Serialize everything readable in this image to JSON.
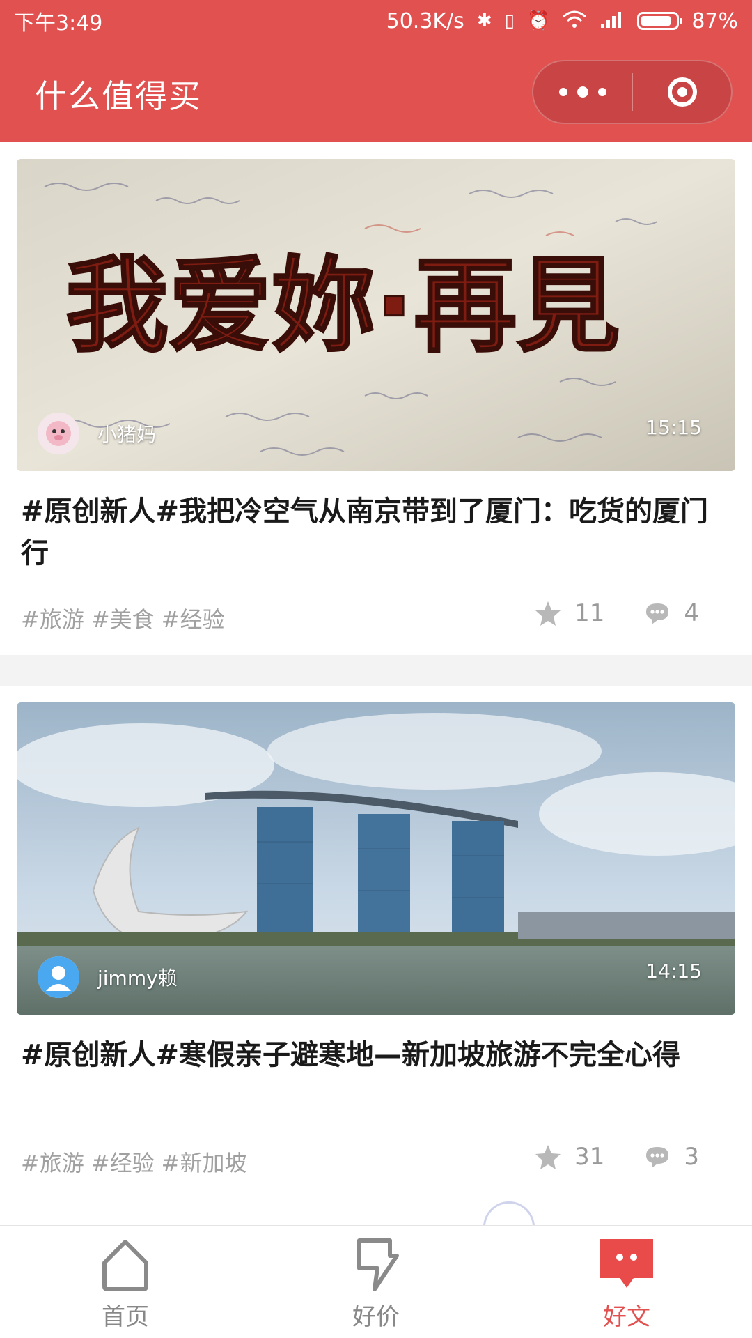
{
  "status_bar": {
    "time": "下午3:49",
    "network_speed": "50.3K/s",
    "battery_percent": "87%",
    "battery_level": 0.87,
    "icons": [
      "bluetooth-icon",
      "vibrate-icon",
      "alarm-icon",
      "wifi-icon",
      "signal-icon",
      "battery-icon"
    ]
  },
  "header": {
    "title": "什么值得买",
    "more_icon": "more-dots-icon",
    "close_icon": "target-circle-icon"
  },
  "articles": [
    {
      "cover_icon": "graffiti-wall-image",
      "cover_text": "我爱妳·再見",
      "author": "小猪妈",
      "time": "15:15",
      "title": "#原创新人#我把冷空气从南京带到了厦门：吃货的厦门行",
      "tags": [
        "#旅游",
        "#美食",
        "#经验"
      ],
      "stars": "11",
      "comments": "4"
    },
    {
      "cover_icon": "marina-bay-sands-image",
      "author": "jimmy赖",
      "time": "14:15",
      "title": "#原创新人#寒假亲子避寒地—新加坡旅游不完全心得",
      "tags": [
        "#旅游",
        "#经验",
        "#新加坡"
      ],
      "stars": "31",
      "comments": "3"
    }
  ],
  "tabbar": {
    "tabs": [
      {
        "label": "首页",
        "icon": "home-icon"
      },
      {
        "label": "好价",
        "icon": "lightning-tag-icon"
      },
      {
        "label": "好文",
        "icon": "chat-bubble-icon"
      }
    ],
    "active": "好文",
    "accent": "#e05150"
  }
}
